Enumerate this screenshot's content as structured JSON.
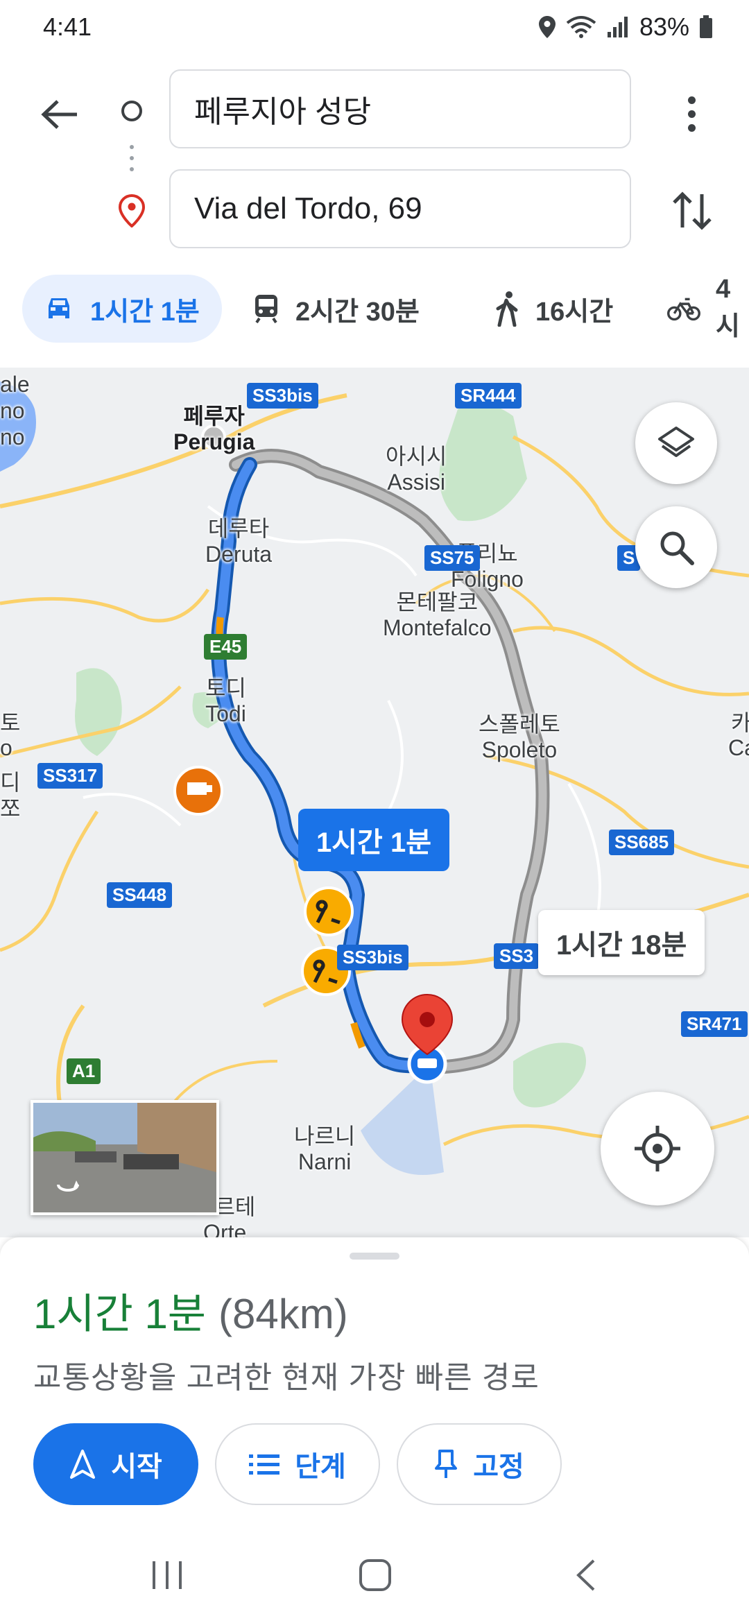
{
  "status": {
    "time": "4:41",
    "battery": "83%"
  },
  "route": {
    "origin": "페루지아 성당",
    "destination": "Via del Tordo, 69"
  },
  "modes": [
    {
      "name": "drive",
      "label": "1시간 1분",
      "icon": "car-icon",
      "active": true
    },
    {
      "name": "transit",
      "label": "2시간 30분",
      "icon": "train-icon",
      "active": false
    },
    {
      "name": "walk",
      "label": "16시간",
      "icon": "walk-icon",
      "active": false
    },
    {
      "name": "bike",
      "label": "4시",
      "icon": "bike-icon",
      "active": false
    }
  ],
  "map": {
    "places": [
      {
        "ko": "페루자",
        "en": "Perugia"
      },
      {
        "ko": "아시시",
        "en": "Assisi"
      },
      {
        "ko": "데루타",
        "en": "Deruta"
      },
      {
        "ko": "폴리뇨",
        "en": "Foligno"
      },
      {
        "ko": "몬테팔코",
        "en": "Montefalco"
      },
      {
        "ko": "토디",
        "en": "Todi"
      },
      {
        "ko": "스폴레토",
        "en": "Spoleto"
      },
      {
        "ko": "나르니",
        "en": "Narni"
      },
      {
        "ko": "오르테",
        "en": "Orte"
      }
    ],
    "edge_labels": {
      "left1": "ale",
      "left2": "no",
      "left3": "no",
      "left4": "토",
      "left5": "o",
      "left6": "디",
      "left7": "쪼",
      "right1": "카",
      "right2": "Ca"
    },
    "shields": [
      "SS3bis",
      "SR444",
      "SS75",
      "E45",
      "SS317",
      "SS685",
      "SS448",
      "SS3bis",
      "SS3",
      "SR471",
      "A1",
      "S"
    ],
    "route_bubble": "1시간 1분",
    "alt_route_bubble": "1시간 18분",
    "colors": {
      "route": "#1a73e8",
      "alt_route": "#9e9e9e",
      "green": "#c8e6c9"
    }
  },
  "sheet": {
    "duration": "1시간 1분",
    "distance": "(84km)",
    "description": "교통상황을 고려한 현재 가장 빠른 경로",
    "buttons": {
      "start": "시작",
      "steps": "단계",
      "pin": "고정"
    }
  }
}
